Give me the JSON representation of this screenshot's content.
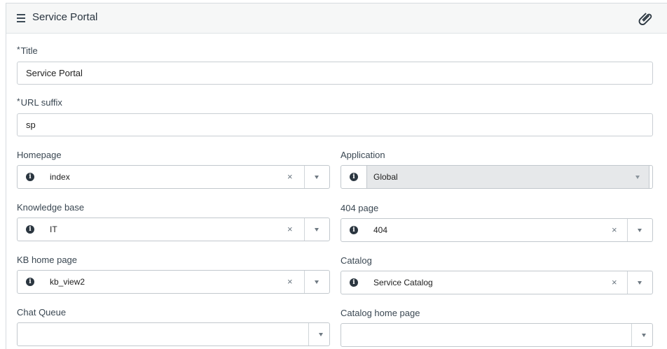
{
  "header": {
    "title": "Service Portal",
    "menu_icon": "hamburger-menu-icon",
    "attachment_icon": "paperclip-icon"
  },
  "form": {
    "required_marker": "*",
    "title": {
      "label": "Title",
      "value": "Service Portal"
    },
    "url_suffix": {
      "label": "URL suffix",
      "value": "sp"
    },
    "homepage": {
      "label": "Homepage",
      "value": "index"
    },
    "application": {
      "label": "Application",
      "value": "Global"
    },
    "knowledge_base": {
      "label": "Knowledge base",
      "value": "IT"
    },
    "page_404": {
      "label": "404 page",
      "value": "404"
    },
    "kb_home_page": {
      "label": "KB home page",
      "value": "kb_view2"
    },
    "catalog": {
      "label": "Catalog",
      "value": "Service Catalog"
    },
    "chat_queue": {
      "label": "Chat Queue",
      "value": ""
    },
    "catalog_home_page": {
      "label": "Catalog home page",
      "value": ""
    }
  },
  "glyphs": {
    "info": "i",
    "clear": "×"
  }
}
